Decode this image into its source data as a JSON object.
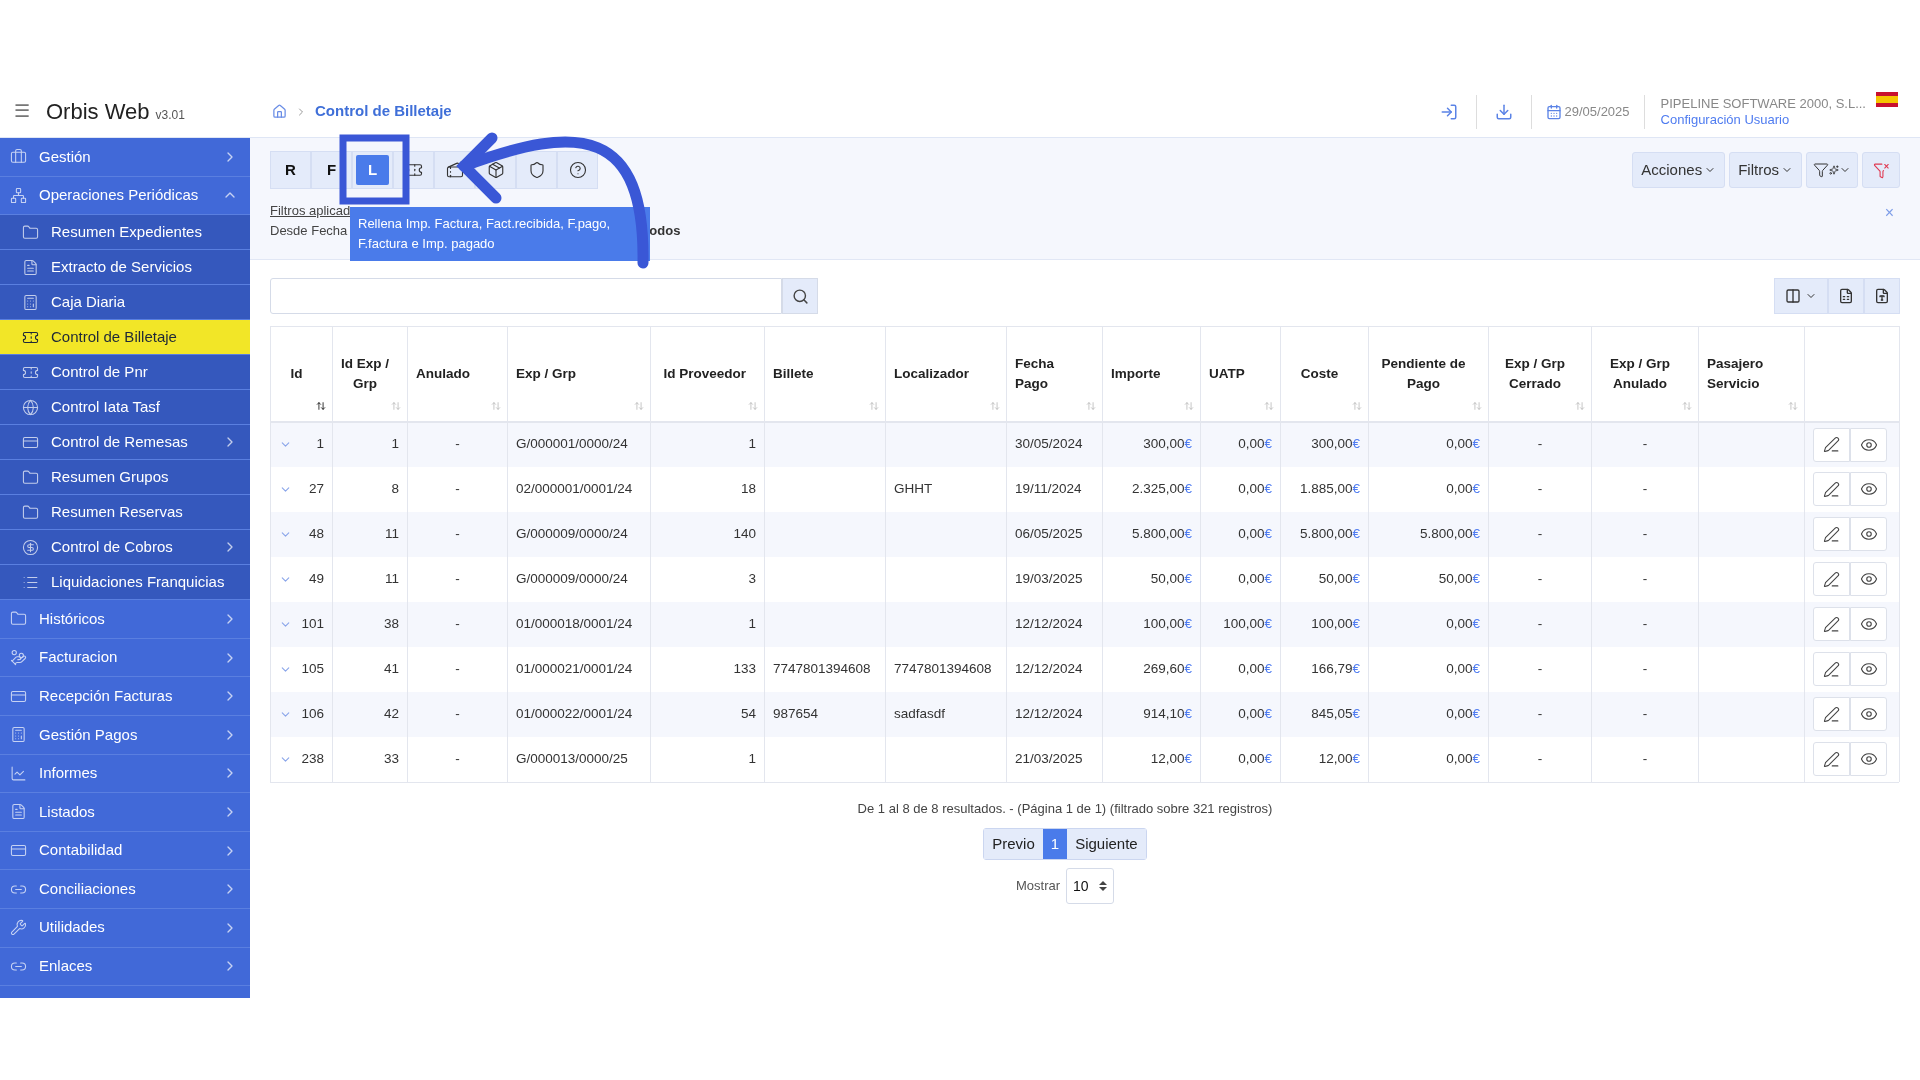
{
  "app": {
    "menu_label": "☰",
    "title": "Orbis Web",
    "version": "v3.01"
  },
  "breadcrumb": {
    "current": "Control de Billetaje"
  },
  "header": {
    "date": "29/05/2025",
    "company": "PIPELINE SOFTWARE 2000, S.L...",
    "user_link": "Configuración Usuario"
  },
  "sidebar": {
    "items": [
      {
        "label": "Gestión",
        "expanded": false,
        "has_children": true,
        "selected": false
      },
      {
        "label": "Operaciones Periódicas",
        "expanded": true,
        "has_children": true,
        "selected": false,
        "children": [
          {
            "label": "Resumen Expedientes",
            "has_children": false,
            "selected": false
          },
          {
            "label": "Extracto de Servicios",
            "has_children": false,
            "selected": false
          },
          {
            "label": "Caja Diaria",
            "has_children": false,
            "selected": false
          },
          {
            "label": "Control de Billetaje",
            "has_children": false,
            "selected": true
          },
          {
            "label": "Control de Pnr",
            "has_children": false,
            "selected": false
          },
          {
            "label": "Control Iata Tasf",
            "has_children": false,
            "selected": false
          },
          {
            "label": "Control de Remesas",
            "has_children": true,
            "selected": false
          },
          {
            "label": "Resumen Grupos",
            "has_children": false,
            "selected": false
          },
          {
            "label": "Resumen Reservas",
            "has_children": false,
            "selected": false
          },
          {
            "label": "Control de Cobros",
            "has_children": true,
            "selected": false
          },
          {
            "label": "Liquidaciones Franquicias",
            "has_children": false,
            "selected": false
          }
        ]
      },
      {
        "label": "Históricos",
        "expanded": false,
        "has_children": true,
        "selected": false
      },
      {
        "label": "Facturacion",
        "expanded": false,
        "has_children": true,
        "selected": false
      },
      {
        "label": "Recepción Facturas",
        "expanded": false,
        "has_children": true,
        "selected": false
      },
      {
        "label": "Gestión Pagos",
        "expanded": false,
        "has_children": true,
        "selected": false
      },
      {
        "label": "Informes",
        "expanded": false,
        "has_children": true,
        "selected": false
      },
      {
        "label": "Listados",
        "expanded": false,
        "has_children": true,
        "selected": false
      },
      {
        "label": "Contabilidad",
        "expanded": false,
        "has_children": true,
        "selected": false
      },
      {
        "label": "Conciliaciones",
        "expanded": false,
        "has_children": true,
        "selected": false
      },
      {
        "label": "Utilidades",
        "expanded": false,
        "has_children": true,
        "selected": false
      },
      {
        "label": "Enlaces",
        "expanded": false,
        "has_children": true,
        "selected": false
      }
    ]
  },
  "toolbar": {
    "buttons": [
      {
        "label": "R",
        "selected": false
      },
      {
        "label": "F",
        "selected": false
      },
      {
        "label": "L",
        "selected": true
      }
    ],
    "tooltip": "Rellena Imp. Factura, Fact.recibida, F.pago, F.factura e Imp. pagado",
    "right_buttons": [
      "Acciones",
      "Filtros"
    ],
    "close": "×"
  },
  "filters": {
    "link": "Filtros aplicad",
    "line_start": "Desde Fecha",
    "line_end": "odos"
  },
  "table": {
    "columns": [
      {
        "label": "Id",
        "sorted": true
      },
      {
        "label": "Id Exp / Grp",
        "sorted": false
      },
      {
        "label": "Anulado",
        "sorted": false
      },
      {
        "label": "Exp / Grp",
        "sorted": false
      },
      {
        "label": "Id Proveedor",
        "sorted": false
      },
      {
        "label": "Billete",
        "sorted": false
      },
      {
        "label": "Localizador",
        "sorted": false
      },
      {
        "label": "Fecha Pago",
        "sorted": false
      },
      {
        "label": "Importe",
        "sorted": false
      },
      {
        "label": "UATP",
        "sorted": false
      },
      {
        "label": "Coste",
        "sorted": false
      },
      {
        "label": "Pendiente de Pago",
        "sorted": false
      },
      {
        "label": "Exp / Grp Cerrado",
        "sorted": false
      },
      {
        "label": "Exp / Grp Anulado",
        "sorted": false
      },
      {
        "label": "Pasajero Servicio",
        "sorted": false
      }
    ],
    "rows": [
      {
        "cells": [
          "1",
          "1",
          "-",
          "G/000001/0000/24",
          "1",
          null,
          null,
          "30/05/2024",
          {
            "amount": "300,00",
            "currency": "€"
          },
          {
            "amount": "0,00",
            "currency": "€"
          },
          {
            "amount": "300,00",
            "currency": "€"
          },
          {
            "amount": "0,00",
            "currency": "€"
          },
          "-",
          "-",
          null
        ]
      },
      {
        "cells": [
          "27",
          "8",
          "-",
          "02/000001/0001/24",
          "18",
          null,
          "GHHT",
          "19/11/2024",
          {
            "amount": "2.325,00",
            "currency": "€"
          },
          {
            "amount": "0,00",
            "currency": "€"
          },
          {
            "amount": "1.885,00",
            "currency": "€"
          },
          {
            "amount": "0,00",
            "currency": "€"
          },
          "-",
          "-",
          null
        ]
      },
      {
        "cells": [
          "48",
          "11",
          "-",
          "G/000009/0000/24",
          "140",
          null,
          null,
          "06/05/2025",
          {
            "amount": "5.800,00",
            "currency": "€"
          },
          {
            "amount": "0,00",
            "currency": "€"
          },
          {
            "amount": "5.800,00",
            "currency": "€"
          },
          {
            "amount": "5.800,00",
            "currency": "€"
          },
          "-",
          "-",
          null
        ]
      },
      {
        "cells": [
          "49",
          "11",
          "-",
          "G/000009/0000/24",
          "3",
          null,
          null,
          "19/03/2025",
          {
            "amount": "50,00",
            "currency": "€"
          },
          {
            "amount": "0,00",
            "currency": "€"
          },
          {
            "amount": "50,00",
            "currency": "€"
          },
          {
            "amount": "50,00",
            "currency": "€"
          },
          "-",
          "-",
          null
        ]
      },
      {
        "cells": [
          "101",
          "38",
          "-",
          "01/000018/0001/24",
          "1",
          null,
          null,
          "12/12/2024",
          {
            "amount": "100,00",
            "currency": "€"
          },
          {
            "amount": "100,00",
            "currency": "€"
          },
          {
            "amount": "100,00",
            "currency": "€"
          },
          {
            "amount": "0,00",
            "currency": "€"
          },
          "-",
          "-",
          null
        ]
      },
      {
        "cells": [
          "105",
          "41",
          "-",
          "01/000021/0001/24",
          "133",
          "7747801394608",
          "7747801394608",
          "12/12/2024",
          {
            "amount": "269,60",
            "currency": "€"
          },
          {
            "amount": "0,00",
            "currency": "€"
          },
          {
            "amount": "166,79",
            "currency": "€"
          },
          {
            "amount": "0,00",
            "currency": "€"
          },
          "-",
          "-",
          null
        ]
      },
      {
        "cells": [
          "106",
          "42",
          "-",
          "01/000022/0001/24",
          "54",
          "987654",
          "sadfasdf",
          "12/12/2024",
          {
            "amount": "914,10",
            "currency": "€"
          },
          {
            "amount": "0,00",
            "currency": "€"
          },
          {
            "amount": "845,05",
            "currency": "€"
          },
          {
            "amount": "0,00",
            "currency": "€"
          },
          "-",
          "-",
          null
        ]
      },
      {
        "cells": [
          "238",
          "33",
          "-",
          "G/000013/0000/25",
          "1",
          null,
          null,
          "21/03/2025",
          {
            "amount": "12,00",
            "currency": "€"
          },
          {
            "amount": "0,00",
            "currency": "€"
          },
          {
            "amount": "12,00",
            "currency": "€"
          },
          {
            "amount": "0,00",
            "currency": "€"
          },
          "-",
          "-",
          null
        ]
      }
    ]
  },
  "pagination": {
    "summary": "De 1 al 8 de 8 resultados. - (Página 1 de 1) (filtrado sobre 321 registros)",
    "pages": [
      {
        "label": "Previo",
        "selected": false
      },
      {
        "label": "1",
        "selected": true
      },
      {
        "label": "Siguiente",
        "selected": false
      }
    ],
    "show_label": "Mostrar",
    "page_size": "10"
  }
}
